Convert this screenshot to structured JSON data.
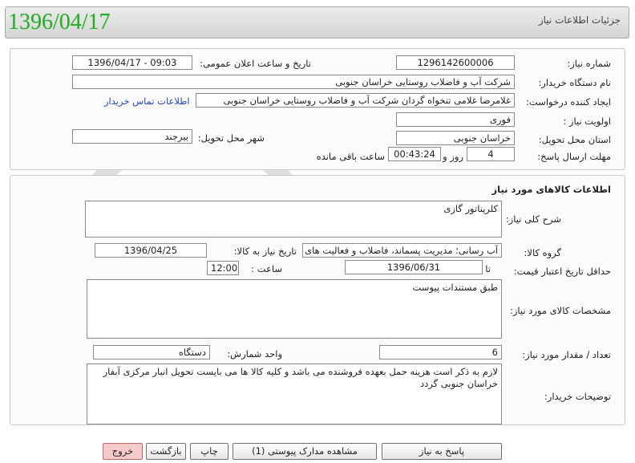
{
  "header": {
    "date": "1396/04/17",
    "title": "جزئیات اطلاعات نیاز"
  },
  "form": {
    "need_number_label": "شماره نیاز:",
    "need_number": "1296142600006",
    "announce_label": "تاریخ و ساعت اعلان عمومی:",
    "announce_value": "1396/04/17 - 09:03",
    "buyer_label": "نام دستگاه خریدار:",
    "buyer_value": "شرکت آب و فاضلاب روستایی خراسان جنوبی",
    "creator_label": "ایجاد کننده درخواست:",
    "creator_value": "غلامرضا غلامی تنخواه گردان شرکت آب و فاضلاب روستایی خراسان جنوبی",
    "contact_link": "اطلاعات تماس خریدار",
    "priority_label": "اولویت نیاز :",
    "priority_value": "فوری",
    "province_label": "استان محل تحویل:",
    "province_value": "خراسان جنوبی",
    "city_label": "شهر محل تحویل:",
    "city_value": "بیرجند",
    "deadline_label": "مهلت ارسال پاسخ:",
    "deadline_days": "4",
    "days_word": "روز و",
    "deadline_time": "00:43:24",
    "remaining_word": "ساعت باقی مانده"
  },
  "goods": {
    "section_title": "اطلاعات کالاهای مورد نیاز",
    "desc_label": "شرح کلی نیاز:",
    "desc_value": "کلرپناتور گازی",
    "group_label": "گروه کالا:",
    "group_value": "آب رسانی؛ مدیریت پسماند، فاضلاب و فعالیت های",
    "need_date_label": "تاریخ نیاز به کالا:",
    "need_date_value": "1396/04/25",
    "min_price_label": "حداقل تاریخ اعتبار قیمت:",
    "until_date_label": "تا تاریخ :",
    "until_date_value": "1396/06/31",
    "time_label": "ساعت :",
    "time_value": "12:00",
    "specs_label": "مشخصات کالای مورد نیاز:",
    "specs_value": "طبق مستندات پیوست",
    "qty_label": "تعداد / مقدار مورد نیاز:",
    "qty_value": "6",
    "unit_label": "واحد شمارش:",
    "unit_value": "دستگاه",
    "notes_label": "توضیحات خریدار:",
    "notes_value": "لازم به ذکر است هزینه حمل بعهده فروشنده می باشد و کلیه کالا ها می بایست تحویل انبار مرکزی آبفار خراسان جنوبی گردد"
  },
  "buttons": {
    "reply": "پاسخ به نیاز",
    "attachments": "مشاهده مدارک پیوستی (1)",
    "print": "چاپ",
    "back": "بازگشت",
    "exit": "خروج"
  },
  "colors": {
    "header_date": "#2ea52e",
    "link": "#1f46c4",
    "exit_button": "#f7caca"
  }
}
